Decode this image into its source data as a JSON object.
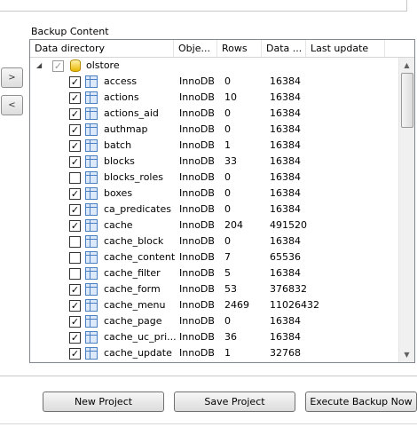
{
  "group_label": "Backup Content",
  "columns": [
    "Data directory",
    "Obje...",
    "Rows",
    "Data ...",
    "Last update"
  ],
  "root": {
    "name": "olstore",
    "checked": true
  },
  "tables": [
    {
      "name": "access",
      "engine": "InnoDB",
      "rows": "0",
      "data": "16384",
      "checked": true
    },
    {
      "name": "actions",
      "engine": "InnoDB",
      "rows": "10",
      "data": "16384",
      "checked": true
    },
    {
      "name": "actions_aid",
      "engine": "InnoDB",
      "rows": "0",
      "data": "16384",
      "checked": true
    },
    {
      "name": "authmap",
      "engine": "InnoDB",
      "rows": "0",
      "data": "16384",
      "checked": true
    },
    {
      "name": "batch",
      "engine": "InnoDB",
      "rows": "1",
      "data": "16384",
      "checked": true
    },
    {
      "name": "blocks",
      "engine": "InnoDB",
      "rows": "33",
      "data": "16384",
      "checked": true
    },
    {
      "name": "blocks_roles",
      "engine": "InnoDB",
      "rows": "0",
      "data": "16384",
      "checked": false
    },
    {
      "name": "boxes",
      "engine": "InnoDB",
      "rows": "0",
      "data": "16384",
      "checked": true
    },
    {
      "name": "ca_predicates",
      "engine": "InnoDB",
      "rows": "0",
      "data": "16384",
      "checked": true
    },
    {
      "name": "cache",
      "engine": "InnoDB",
      "rows": "204",
      "data": "491520",
      "checked": true
    },
    {
      "name": "cache_block",
      "engine": "InnoDB",
      "rows": "0",
      "data": "16384",
      "checked": false
    },
    {
      "name": "cache_content",
      "engine": "InnoDB",
      "rows": "7",
      "data": "65536",
      "checked": false
    },
    {
      "name": "cache_filter",
      "engine": "InnoDB",
      "rows": "5",
      "data": "16384",
      "checked": false
    },
    {
      "name": "cache_form",
      "engine": "InnoDB",
      "rows": "53",
      "data": "376832",
      "checked": true
    },
    {
      "name": "cache_menu",
      "engine": "InnoDB",
      "rows": "2469",
      "data": "11026432",
      "checked": true
    },
    {
      "name": "cache_page",
      "engine": "InnoDB",
      "rows": "0",
      "data": "16384",
      "checked": true
    },
    {
      "name": "cache_uc_pri...",
      "engine": "InnoDB",
      "rows": "36",
      "data": "16384",
      "checked": true
    },
    {
      "name": "cache_update",
      "engine": "InnoDB",
      "rows": "1",
      "data": "32768",
      "checked": true
    }
  ],
  "buttons": {
    "new_project": "New Project",
    "save_project": "Save Project",
    "execute_backup": "Execute Backup Now"
  },
  "nav": {
    "add": ">",
    "remove": "<"
  }
}
